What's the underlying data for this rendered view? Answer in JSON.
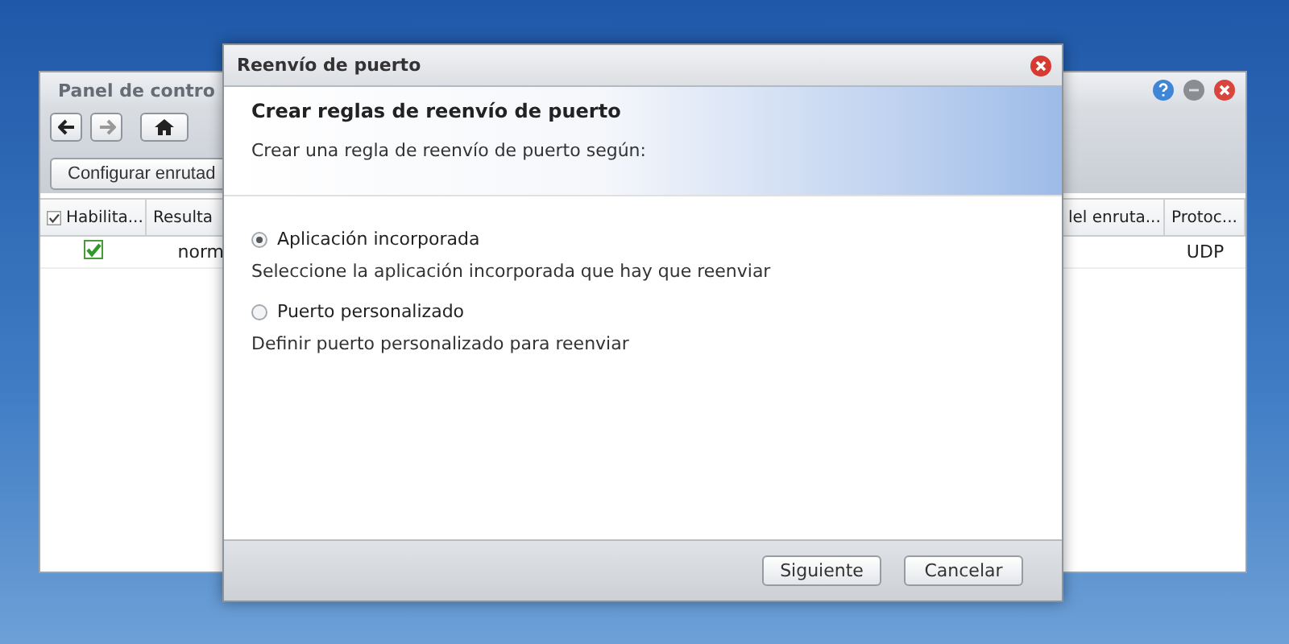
{
  "back_window": {
    "title": "Panel de contro",
    "toolbar_button": "Configurar enrutad",
    "header_checked": true,
    "left_columns": [
      "Habilita...",
      "Resulta"
    ],
    "right_columns": [
      "lel enruta...",
      "Protoc..."
    ],
    "rows": [
      {
        "checked": true,
        "column_2": "norm",
        "column_last": "UDP"
      }
    ]
  },
  "dialog": {
    "title": "Reenvío de puerto",
    "heading": "Crear reglas de reenvío de puerto",
    "subheading": "Crear una regla de reenvío de puerto según:",
    "options": [
      {
        "label": "Aplicación incorporada",
        "description": "Seleccione la aplicación incorporada que hay que reenviar",
        "selected": true
      },
      {
        "label": "Puerto personalizado",
        "description": "Definir puerto personalizado para reenviar",
        "selected": false
      }
    ],
    "buttons": [
      "Siguiente",
      "Cancelar"
    ]
  }
}
